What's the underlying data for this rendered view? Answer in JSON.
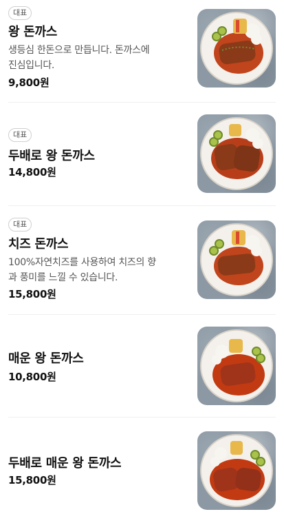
{
  "menu": {
    "items": [
      {
        "badge": "대표",
        "name": "왕 돈까스",
        "description_line1": "생등심 한돈으로 만듭니다. 돈까스에",
        "description_line2": "진심입니다.",
        "price": "9,800원",
        "image": "pork-cutlet-plate-icon"
      },
      {
        "badge": "대표",
        "name": "두배로 왕 돈까스",
        "description_line1": "",
        "description_line2": "",
        "price": "14,800원",
        "image": "pork-cutlet-plate-icon"
      },
      {
        "badge": "대표",
        "name": "치즈 돈까스",
        "description_line1": "100%자연치즈를 사용하여 치즈의 향",
        "description_line2": "과 풍미를 느낄 수 있습니다.",
        "price": "15,800원",
        "image": "pork-cutlet-plate-icon"
      },
      {
        "badge": "",
        "name": "매운 왕 돈까스",
        "description_line1": "",
        "description_line2": "",
        "price": "10,800원",
        "image": "pork-cutlet-plate-icon"
      },
      {
        "badge": "",
        "name": "두배로 매운 왕 돈까스",
        "description_line1": "",
        "description_line2": "",
        "price": "15,800원",
        "image": "pork-cutlet-plate-icon"
      }
    ]
  }
}
